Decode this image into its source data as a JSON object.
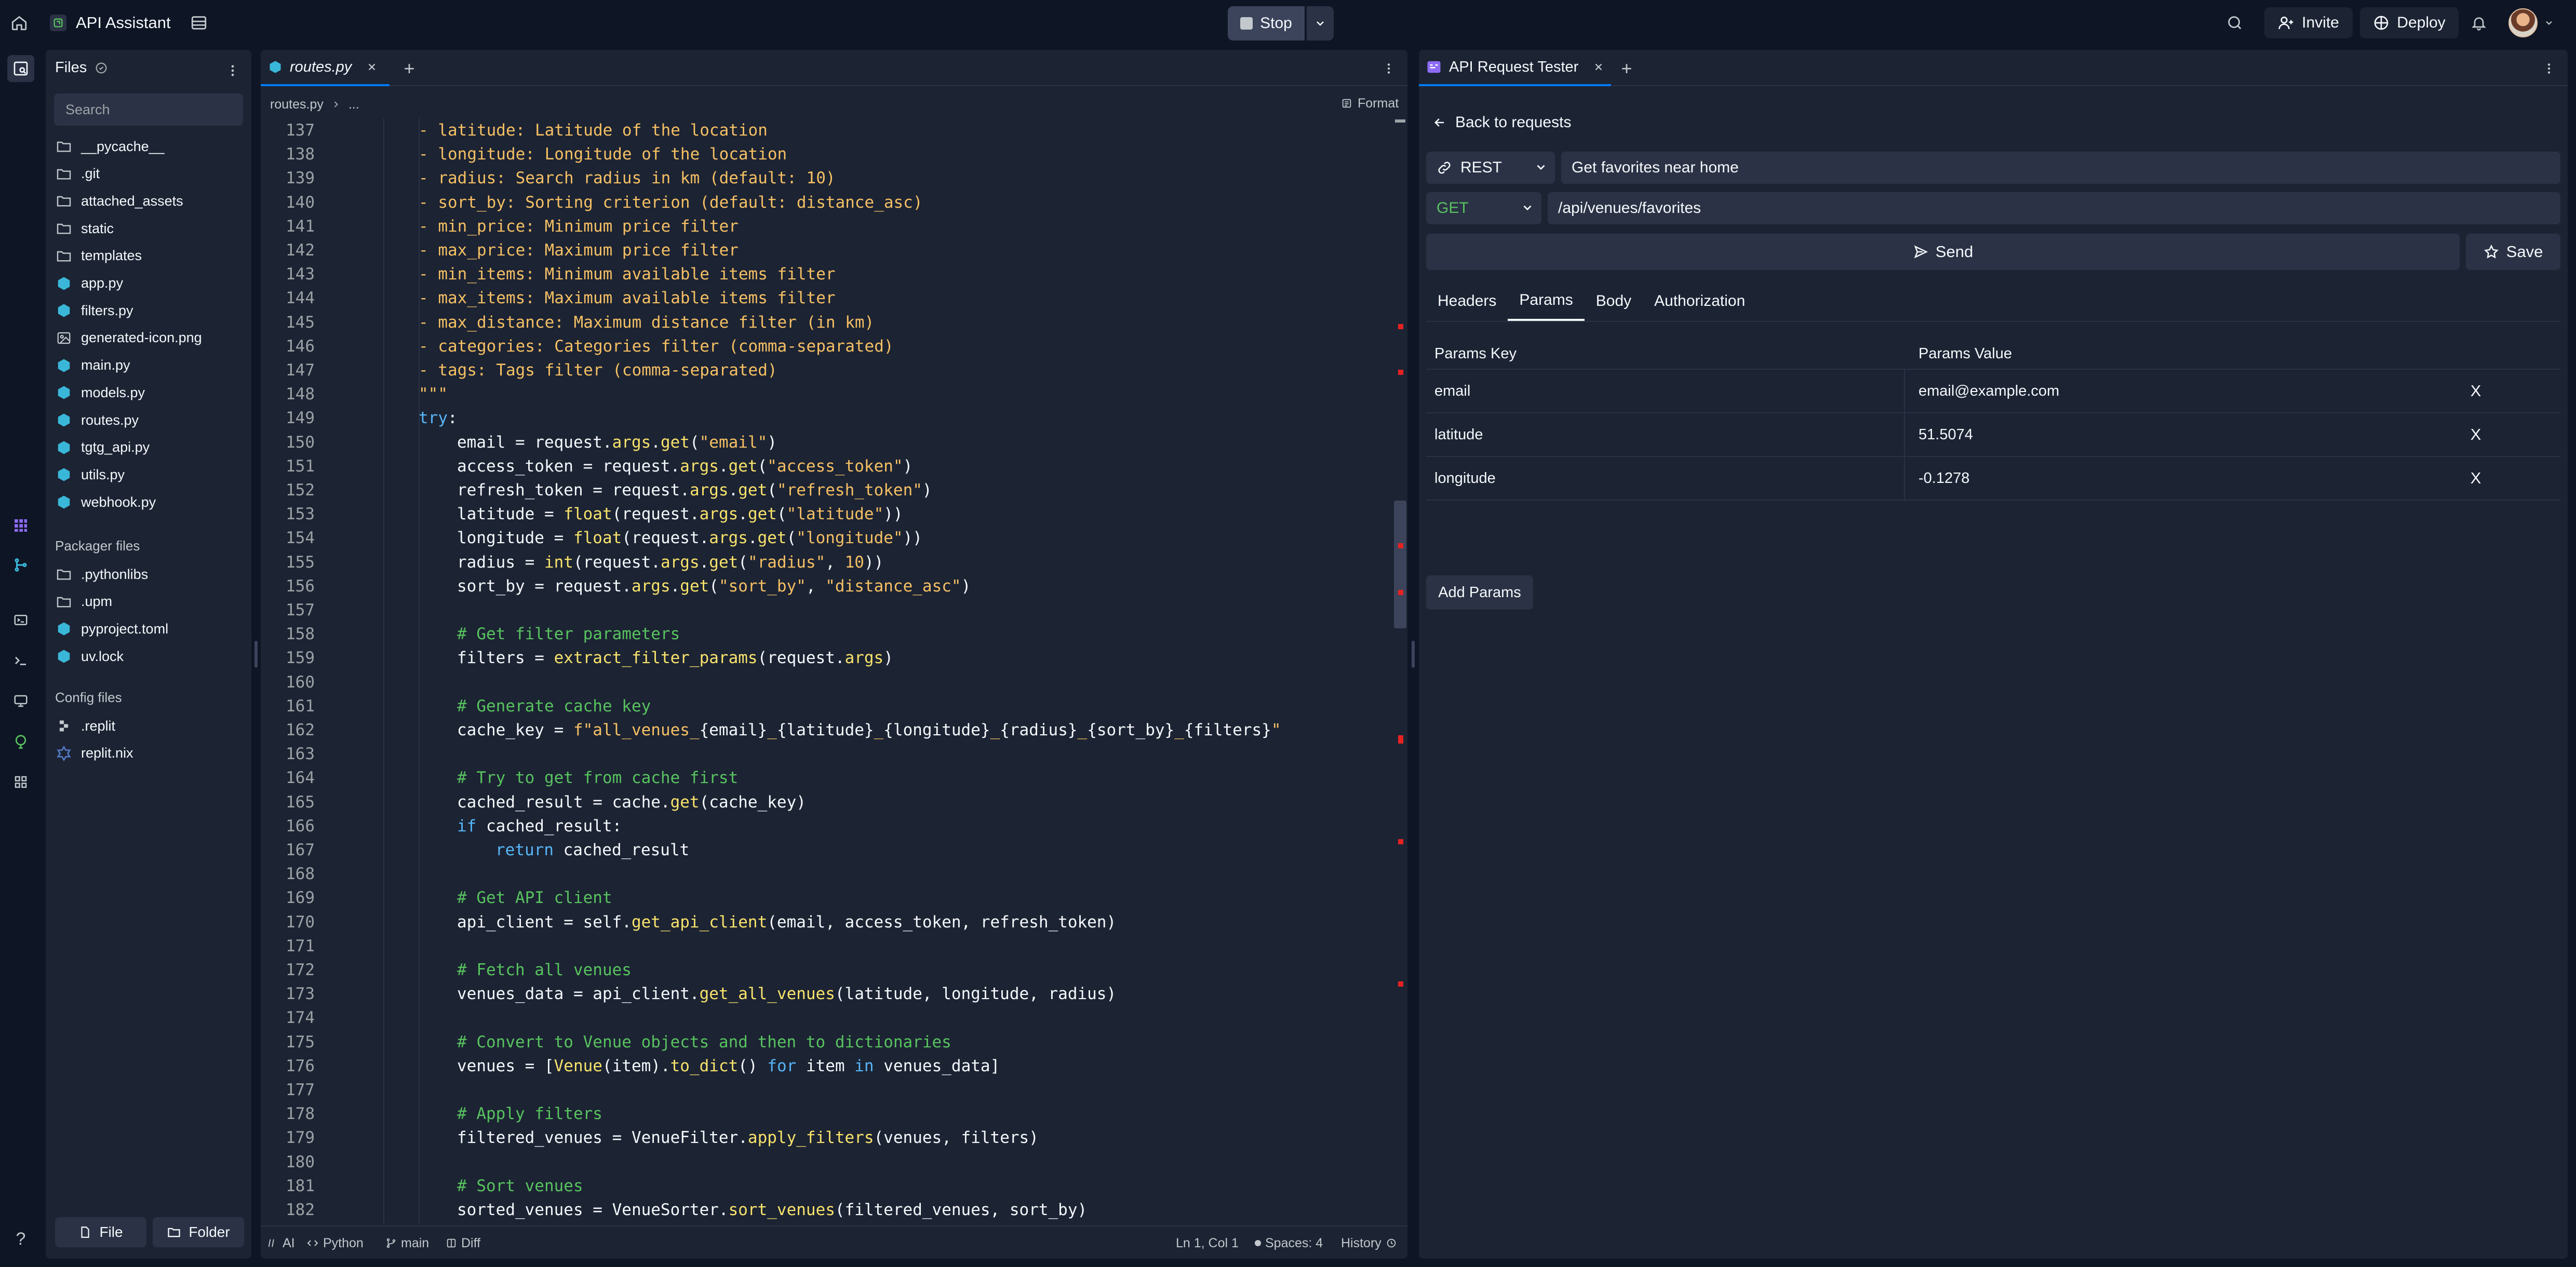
{
  "app": {
    "repl_name": "API Assistant",
    "stop_label": "Stop",
    "invite_label": "Invite",
    "deploy_label": "Deploy"
  },
  "files": {
    "header": "Files",
    "search_placeholder": "Search",
    "items": [
      {
        "name": "__pycache__",
        "type": "folder"
      },
      {
        "name": ".git",
        "type": "folder"
      },
      {
        "name": "attached_assets",
        "type": "folder"
      },
      {
        "name": "static",
        "type": "folder"
      },
      {
        "name": "templates",
        "type": "folder"
      },
      {
        "name": "app.py",
        "type": "python"
      },
      {
        "name": "filters.py",
        "type": "python"
      },
      {
        "name": "generated-icon.png",
        "type": "image"
      },
      {
        "name": "main.py",
        "type": "python"
      },
      {
        "name": "models.py",
        "type": "python"
      },
      {
        "name": "routes.py",
        "type": "python"
      },
      {
        "name": "tgtg_api.py",
        "type": "python"
      },
      {
        "name": "utils.py",
        "type": "python"
      },
      {
        "name": "webhook.py",
        "type": "python"
      }
    ],
    "packager_title": "Packager files",
    "packager_items": [
      {
        "name": ".pythonlibs",
        "type": "folder"
      },
      {
        "name": ".upm",
        "type": "folder"
      },
      {
        "name": "pyproject.toml",
        "type": "python"
      },
      {
        "name": "uv.lock",
        "type": "python"
      }
    ],
    "config_title": "Config files",
    "config_items": [
      {
        "name": ".replit",
        "type": "replit"
      },
      {
        "name": "replit.nix",
        "type": "nix"
      }
    ],
    "new_file_label": "File",
    "new_folder_label": "Folder"
  },
  "editor": {
    "tab_label": "routes.py",
    "breadcrumb_file": "routes.py",
    "breadcrumb_more": "...",
    "format_label": "Format",
    "lines": [
      {
        "n": "137",
        "indent": 0,
        "tokens": [
          [
            "str",
            "- latitude: Latitude of the location"
          ]
        ]
      },
      {
        "n": "138",
        "indent": 0,
        "tokens": [
          [
            "str",
            "- longitude: Longitude of the location"
          ]
        ]
      },
      {
        "n": "139",
        "indent": 0,
        "tokens": [
          [
            "str",
            "- radius: Search radius in km (default: 10)"
          ]
        ]
      },
      {
        "n": "140",
        "indent": 0,
        "tokens": [
          [
            "str",
            "- sort_by: Sorting criterion (default: distance_asc)"
          ]
        ]
      },
      {
        "n": "141",
        "indent": 0,
        "tokens": [
          [
            "str",
            "- min_price: Minimum price filter"
          ]
        ]
      },
      {
        "n": "142",
        "indent": 0,
        "tokens": [
          [
            "str",
            "- max_price: Maximum price filter"
          ]
        ]
      },
      {
        "n": "143",
        "indent": 0,
        "tokens": [
          [
            "str",
            "- min_items: Minimum available items filter"
          ]
        ]
      },
      {
        "n": "144",
        "indent": 0,
        "tokens": [
          [
            "str",
            "- max_items: Maximum available items filter"
          ]
        ]
      },
      {
        "n": "145",
        "indent": 0,
        "tokens": [
          [
            "str",
            "- max_distance: Maximum distance filter (in km)"
          ]
        ]
      },
      {
        "n": "146",
        "indent": 0,
        "tokens": [
          [
            "str",
            "- categories: Categories filter (comma-separated)"
          ]
        ]
      },
      {
        "n": "147",
        "indent": 0,
        "tokens": [
          [
            "str",
            "- tags: Tags filter (comma-separated)"
          ]
        ]
      },
      {
        "n": "148",
        "indent": 0,
        "tokens": [
          [
            "str",
            "\"\"\""
          ]
        ]
      },
      {
        "n": "149",
        "indent": 0,
        "tokens": [
          [
            "kw",
            "try"
          ],
          [
            "var",
            ":"
          ]
        ]
      },
      {
        "n": "150",
        "indent": 1,
        "tokens": [
          [
            "var",
            "email = request."
          ],
          [
            "fn",
            "args"
          ],
          [
            "var",
            "."
          ],
          [
            "fn",
            "get"
          ],
          [
            "var",
            "("
          ],
          [
            "str",
            "\"email\""
          ],
          [
            "var",
            ")"
          ]
        ]
      },
      {
        "n": "151",
        "indent": 1,
        "tokens": [
          [
            "var",
            "access_token = request."
          ],
          [
            "fn",
            "args"
          ],
          [
            "var",
            "."
          ],
          [
            "fn",
            "get"
          ],
          [
            "var",
            "("
          ],
          [
            "str",
            "\"access_token\""
          ],
          [
            "var",
            ")"
          ]
        ]
      },
      {
        "n": "152",
        "indent": 1,
        "tokens": [
          [
            "var",
            "refresh_token = request."
          ],
          [
            "fn",
            "args"
          ],
          [
            "var",
            "."
          ],
          [
            "fn",
            "get"
          ],
          [
            "var",
            "("
          ],
          [
            "str",
            "\"refresh_token\""
          ],
          [
            "var",
            ")"
          ]
        ]
      },
      {
        "n": "153",
        "indent": 1,
        "tokens": [
          [
            "var",
            "latitude = "
          ],
          [
            "fn",
            "float"
          ],
          [
            "var",
            "(request."
          ],
          [
            "fn",
            "args"
          ],
          [
            "var",
            "."
          ],
          [
            "fn",
            "get"
          ],
          [
            "var",
            "("
          ],
          [
            "str",
            "\"latitude\""
          ],
          [
            "var",
            "))"
          ]
        ]
      },
      {
        "n": "154",
        "indent": 1,
        "tokens": [
          [
            "var",
            "longitude = "
          ],
          [
            "fn",
            "float"
          ],
          [
            "var",
            "(request."
          ],
          [
            "fn",
            "args"
          ],
          [
            "var",
            "."
          ],
          [
            "fn",
            "get"
          ],
          [
            "var",
            "("
          ],
          [
            "str",
            "\"longitude\""
          ],
          [
            "var",
            "))"
          ]
        ]
      },
      {
        "n": "155",
        "indent": 1,
        "tokens": [
          [
            "var",
            "radius = "
          ],
          [
            "fn",
            "int"
          ],
          [
            "var",
            "(request."
          ],
          [
            "fn",
            "args"
          ],
          [
            "var",
            "."
          ],
          [
            "fn",
            "get"
          ],
          [
            "var",
            "("
          ],
          [
            "str",
            "\"radius\""
          ],
          [
            "var",
            ", "
          ],
          [
            "num",
            "10"
          ],
          [
            "var",
            "))"
          ]
        ]
      },
      {
        "n": "156",
        "indent": 1,
        "tokens": [
          [
            "var",
            "sort_by = request."
          ],
          [
            "fn",
            "args"
          ],
          [
            "var",
            "."
          ],
          [
            "fn",
            "get"
          ],
          [
            "var",
            "("
          ],
          [
            "str",
            "\"sort_by\""
          ],
          [
            "var",
            ", "
          ],
          [
            "str",
            "\"distance_asc\""
          ],
          [
            "var",
            ")"
          ]
        ]
      },
      {
        "n": "157",
        "indent": 0,
        "tokens": []
      },
      {
        "n": "158",
        "indent": 1,
        "tokens": [
          [
            "cmt",
            "# Get filter parameters"
          ]
        ]
      },
      {
        "n": "159",
        "indent": 1,
        "tokens": [
          [
            "var",
            "filters = "
          ],
          [
            "fn",
            "extract_filter_params"
          ],
          [
            "var",
            "(request."
          ],
          [
            "fn",
            "args"
          ],
          [
            "var",
            ")"
          ]
        ]
      },
      {
        "n": "160",
        "indent": 0,
        "tokens": []
      },
      {
        "n": "161",
        "indent": 1,
        "tokens": [
          [
            "cmt",
            "# Generate cache key"
          ]
        ]
      },
      {
        "n": "162",
        "indent": 1,
        "tokens": [
          [
            "var",
            "cache_key = "
          ],
          [
            "str",
            "f\"all_venues_"
          ],
          [
            "var",
            "{email}"
          ],
          [
            "str",
            "_"
          ],
          [
            "var",
            "{latitude}"
          ],
          [
            "str",
            "_"
          ],
          [
            "var",
            "{longitude}"
          ],
          [
            "str",
            "_"
          ],
          [
            "var",
            "{radius}"
          ],
          [
            "str",
            "_"
          ],
          [
            "var",
            "{sort_by}"
          ],
          [
            "str",
            "_"
          ],
          [
            "var",
            "{filters}"
          ],
          [
            "str",
            "\""
          ]
        ]
      },
      {
        "n": "163",
        "indent": 0,
        "tokens": []
      },
      {
        "n": "164",
        "indent": 1,
        "tokens": [
          [
            "cmt",
            "# Try to get from cache first"
          ]
        ]
      },
      {
        "n": "165",
        "indent": 1,
        "tokens": [
          [
            "var",
            "cached_result = cache."
          ],
          [
            "fn",
            "get"
          ],
          [
            "var",
            "(cache_key)"
          ]
        ]
      },
      {
        "n": "166",
        "indent": 1,
        "tokens": [
          [
            "kw",
            "if"
          ],
          [
            "var",
            " cached_result:"
          ]
        ]
      },
      {
        "n": "167",
        "indent": 2,
        "tokens": [
          [
            "kw",
            "return"
          ],
          [
            "var",
            " cached_result"
          ]
        ]
      },
      {
        "n": "168",
        "indent": 0,
        "tokens": []
      },
      {
        "n": "169",
        "indent": 1,
        "tokens": [
          [
            "cmt",
            "# Get API client"
          ]
        ]
      },
      {
        "n": "170",
        "indent": 1,
        "tokens": [
          [
            "var",
            "api_client = self."
          ],
          [
            "fn",
            "get_api_client"
          ],
          [
            "var",
            "(email, access_token, refresh_token)"
          ]
        ]
      },
      {
        "n": "171",
        "indent": 0,
        "tokens": []
      },
      {
        "n": "172",
        "indent": 1,
        "tokens": [
          [
            "cmt",
            "# Fetch all venues"
          ]
        ]
      },
      {
        "n": "173",
        "indent": 1,
        "tokens": [
          [
            "var",
            "venues_data = api_client."
          ],
          [
            "fn",
            "get_all_venues"
          ],
          [
            "var",
            "(latitude, longitude, radius)"
          ]
        ]
      },
      {
        "n": "174",
        "indent": 0,
        "tokens": []
      },
      {
        "n": "175",
        "indent": 1,
        "tokens": [
          [
            "cmt",
            "# Convert to Venue objects and then to dictionaries"
          ]
        ]
      },
      {
        "n": "176",
        "indent": 1,
        "tokens": [
          [
            "var",
            "venues = ["
          ],
          [
            "fn",
            "Venue"
          ],
          [
            "var",
            "(item)."
          ],
          [
            "fn",
            "to_dict"
          ],
          [
            "var",
            "() "
          ],
          [
            "kw",
            "for"
          ],
          [
            "var",
            " item "
          ],
          [
            "kw",
            "in"
          ],
          [
            "var",
            " venues_data]"
          ]
        ]
      },
      {
        "n": "177",
        "indent": 0,
        "tokens": []
      },
      {
        "n": "178",
        "indent": 1,
        "tokens": [
          [
            "cmt",
            "# Apply filters"
          ]
        ]
      },
      {
        "n": "179",
        "indent": 1,
        "tokens": [
          [
            "var",
            "filtered_venues = VenueFilter."
          ],
          [
            "fn",
            "apply_filters"
          ],
          [
            "var",
            "(venues, filters)"
          ]
        ]
      },
      {
        "n": "180",
        "indent": 0,
        "tokens": []
      },
      {
        "n": "181",
        "indent": 1,
        "tokens": [
          [
            "cmt",
            "# Sort venues"
          ]
        ]
      },
      {
        "n": "182",
        "indent": 1,
        "tokens": [
          [
            "var",
            "sorted_venues = VenueSorter."
          ],
          [
            "fn",
            "sort_venues"
          ],
          [
            "var",
            "(filtered_venues, sort_by)"
          ]
        ]
      }
    ],
    "status": {
      "ai": "AI",
      "language": "Python",
      "branch": "main",
      "diff": "Diff",
      "cursor": "Ln 1, Col 1",
      "spaces": "Spaces: 4",
      "history": "History"
    }
  },
  "tester": {
    "tab_label": "API Request Tester",
    "back_label": "Back to requests",
    "protocol": "REST",
    "request_name": "Get favorites near home",
    "method": "GET",
    "url": "/api/venues/favorites",
    "send_label": "Send",
    "save_label": "Save",
    "tabs": [
      {
        "label": "Headers",
        "active": false
      },
      {
        "label": "Params",
        "active": true
      },
      {
        "label": "Body",
        "active": false
      },
      {
        "label": "Authorization",
        "active": false
      }
    ],
    "params_key_header": "Params Key",
    "params_value_header": "Params Value",
    "params": [
      {
        "key": "email",
        "value": "email@example.com",
        "remove": "X"
      },
      {
        "key": "latitude",
        "value": "51.5074",
        "remove": "X"
      },
      {
        "key": "longitude",
        "value": "-0.1278",
        "remove": "X"
      }
    ],
    "add_params_label": "Add Params"
  },
  "colors": {
    "background": "#0e1525",
    "panel": "#1c2333",
    "control": "#2b3245",
    "accent": "#0079f2",
    "method_get": "#58c35f",
    "python_icon": "#3ab7d8"
  }
}
